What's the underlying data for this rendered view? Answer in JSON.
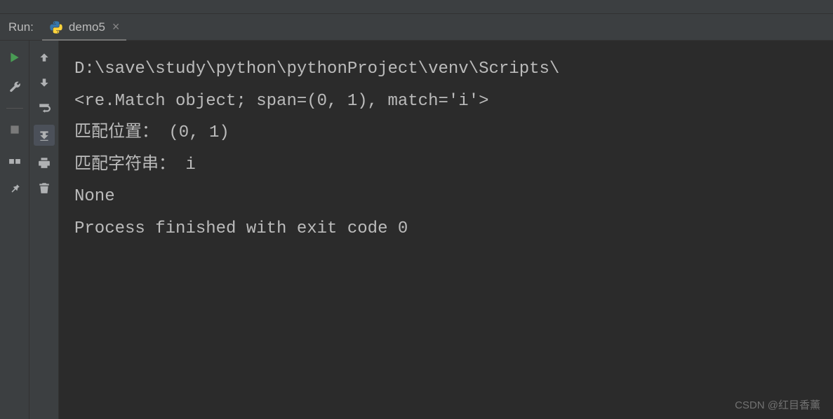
{
  "header": {
    "run_label": "Run:",
    "tab_name": "demo5"
  },
  "console": {
    "line1": "D:\\save\\study\\python\\pythonProject\\venv\\Scripts\\",
    "line2": "<re.Match object; span=(0, 1), match='i'>",
    "line3": "匹配位置： (0, 1)",
    "line4": "匹配字符串： i",
    "line5": "None",
    "line6": "",
    "line7": "Process finished with exit code 0"
  },
  "watermark": "CSDN @红目香薰"
}
